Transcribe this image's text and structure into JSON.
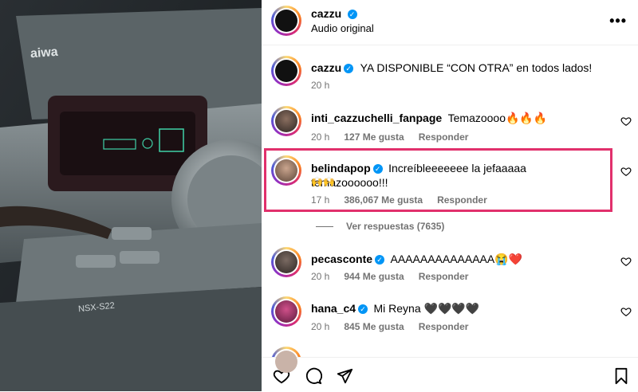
{
  "post": {
    "username": "cazzu",
    "subtitle": "Audio original",
    "brand_text": "aiwa",
    "model_text": "NSX-S22"
  },
  "caption": {
    "username": "cazzu",
    "text": "YA DISPONIBLE “CON OTRA” en todos lados!",
    "time": "20 h"
  },
  "comments": [
    {
      "username": "inti_cazzuchelli_fanpage",
      "verified": false,
      "text": "Temazoooo🔥🔥🔥",
      "time": "20 h",
      "likes": "127 Me gusta",
      "reply": "Responder"
    },
    {
      "username": "belindapop",
      "verified": true,
      "text": "Increíbleeeeeee la jefaaaaa temazoooooo!!!",
      "text2": "🙌🙌",
      "time": "17 h",
      "likes": "386,067 Me gusta",
      "reply": "Responder"
    },
    {
      "username": "pecasconte",
      "verified": true,
      "text": "AAAAAAAAAAAAAA😭❤️",
      "time": "20 h",
      "likes": "944 Me gusta",
      "reply": "Responder"
    },
    {
      "username": "hana_c4",
      "verified": true,
      "text": "Mi Reyna 🖤🖤🖤🖤",
      "time": "20 h",
      "likes": "845 Me gusta",
      "reply": "Responder"
    }
  ],
  "view_replies": "Ver respuestas (7635)",
  "colors": {
    "highlight": "#e1306c",
    "verified": "#0095f6"
  }
}
